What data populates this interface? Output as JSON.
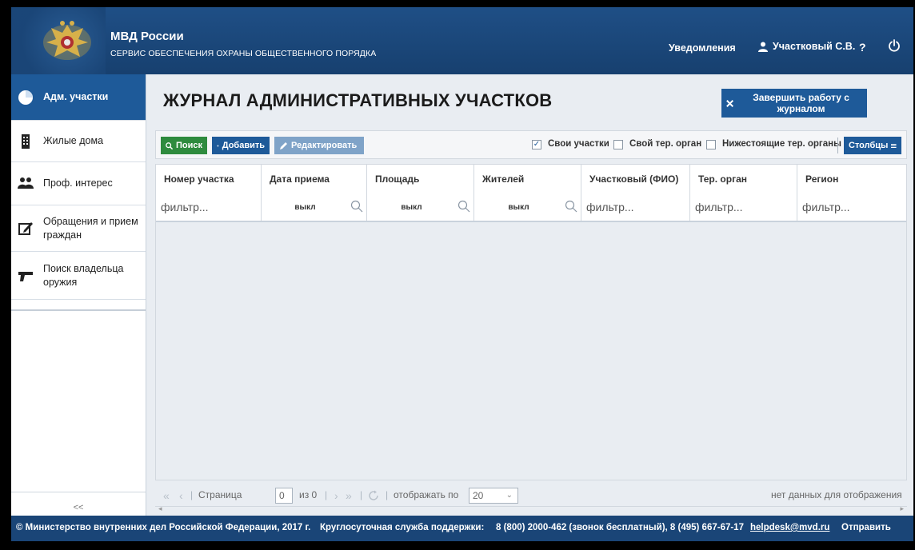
{
  "header": {
    "title": "МВД России",
    "subtitle": "СЕРВИС ОБЕСПЕЧЕНИЯ ОХРАНЫ ОБЩЕСТВЕННОГО ПОРЯДКА",
    "notifications": "Уведомления",
    "user": "Участковый С.В.",
    "help": "?",
    "icons": {
      "user": "user-icon",
      "power": "power-icon",
      "logo": "eagle-emblem-icon"
    }
  },
  "sidebar": {
    "items": [
      {
        "label": "Адм. участки",
        "icon": "pie-chart-icon",
        "active": true
      },
      {
        "label": "Жилые дома",
        "icon": "building-icon",
        "active": false
      },
      {
        "label": "Проф. интерес",
        "icon": "users-icon",
        "active": false
      },
      {
        "label": "Обращения и прием граждан",
        "icon": "edit-icon",
        "active": false
      },
      {
        "label": "Поиск владельца оружия",
        "icon": "pistol-icon",
        "active": false
      }
    ],
    "collapse": "<<"
  },
  "main": {
    "title": "ЖУРНАЛ АДМИНИСТРАТИВНЫХ УЧАСТКОВ",
    "finish_button": "Завершить работу с журналом",
    "toolbar": {
      "search": "Поиск",
      "add": "Добавить",
      "edit": "Редактировать",
      "own_sections": {
        "label": "Свои участки",
        "checked": true
      },
      "own_org": {
        "label": "Свой тер. орган",
        "checked": false
      },
      "lower_orgs": {
        "label": "Нижестоящие тер. органы",
        "checked": false
      },
      "columns": "Столбцы"
    },
    "grid": {
      "columns": [
        "Номер участка",
        "Дата приема",
        "Площадь",
        "Жителей",
        "Участковый (ФИО)",
        "Тер. орган",
        "Регион"
      ],
      "filters": [
        "фильтр...",
        "выкл",
        "выкл",
        "выкл",
        "фильтр...",
        "фильтр...",
        "фильтр..."
      ]
    },
    "pager": {
      "page_label": "Страница",
      "page_value": "0",
      "of_label": "из 0",
      "show_label": "отображать по",
      "page_size": "20",
      "empty": "нет данных для отображения"
    }
  },
  "footer": {
    "copyright": "© Министерство внутренних дел Российской Федерации, 2017 г.",
    "support_label": "Круглосуточная служба поддержки:",
    "phones": "8 (800) 2000-462 (звонок бесплатный), 8 (495) 667-67-17",
    "email": "helpdesk@mvd.ru",
    "send": "Отправить"
  },
  "colors": {
    "primary": "#1e5a99",
    "header": "#1f4f86",
    "search_green": "#2e8b3e",
    "edit_disabled": "#7fa3c8"
  }
}
